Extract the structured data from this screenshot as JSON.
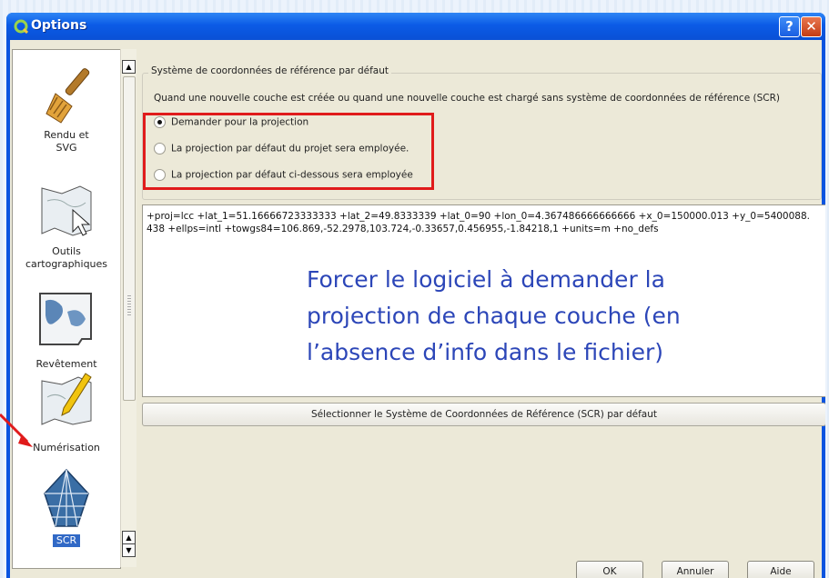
{
  "window": {
    "title": "Options",
    "help_label": "?",
    "close_label": "✕"
  },
  "sidebar": {
    "items": [
      {
        "label_line1": "Rendu et",
        "label_line2": "SVG",
        "icon": "brush-icon"
      },
      {
        "label_line1": "Outils",
        "label_line2": "cartographiques",
        "icon": "map-tools-icon"
      },
      {
        "label_line1": "Revêtement",
        "label_line2": "",
        "icon": "map-overlay-icon"
      },
      {
        "label_line1": "Numérisation",
        "label_line2": "",
        "icon": "digitize-pen-icon"
      },
      {
        "label_line1": "SCR",
        "label_line2": "",
        "icon": "globe-grid-icon",
        "selected": true
      }
    ]
  },
  "crs_group": {
    "legend": "Système de coordonnées de référence par défaut",
    "description": "Quand une nouvelle couche est créée ou quand une nouvelle couche est chargé sans système de coordonnées de référence (SCR)",
    "options": [
      {
        "label": "Demander pour la projection",
        "checked": true
      },
      {
        "label": "La projection par défaut du projet sera employée.",
        "checked": false
      },
      {
        "label": "La projection par défaut ci-dessous sera employée",
        "checked": false
      }
    ]
  },
  "projection": {
    "text": "+proj=lcc +lat_1=51.16666723333333 +lat_2=49.8333339 +lat_0=90 +lon_0=4.367486666666666 +x_0=150000.013 +y_0=5400088.438 +ellps=intl +towgs84=106.869,-52.2978,103.724,-0.33657,0.456955,-1.84218,1 +units=m +no_defs",
    "annotation": "Forcer le logiciel à demander la projection de chaque couche (en l’absence d’info dans le fichier)"
  },
  "select_button": "Sélectionner le Système de Coordonnées de Référence (SCR) par défaut",
  "buttons": {
    "ok": "OK",
    "cancel": "Annuler",
    "help": "Aide"
  },
  "colors": {
    "highlight": "#e01b1b",
    "annotation": "#2c46b8",
    "titlebar": "#0b5be6"
  }
}
